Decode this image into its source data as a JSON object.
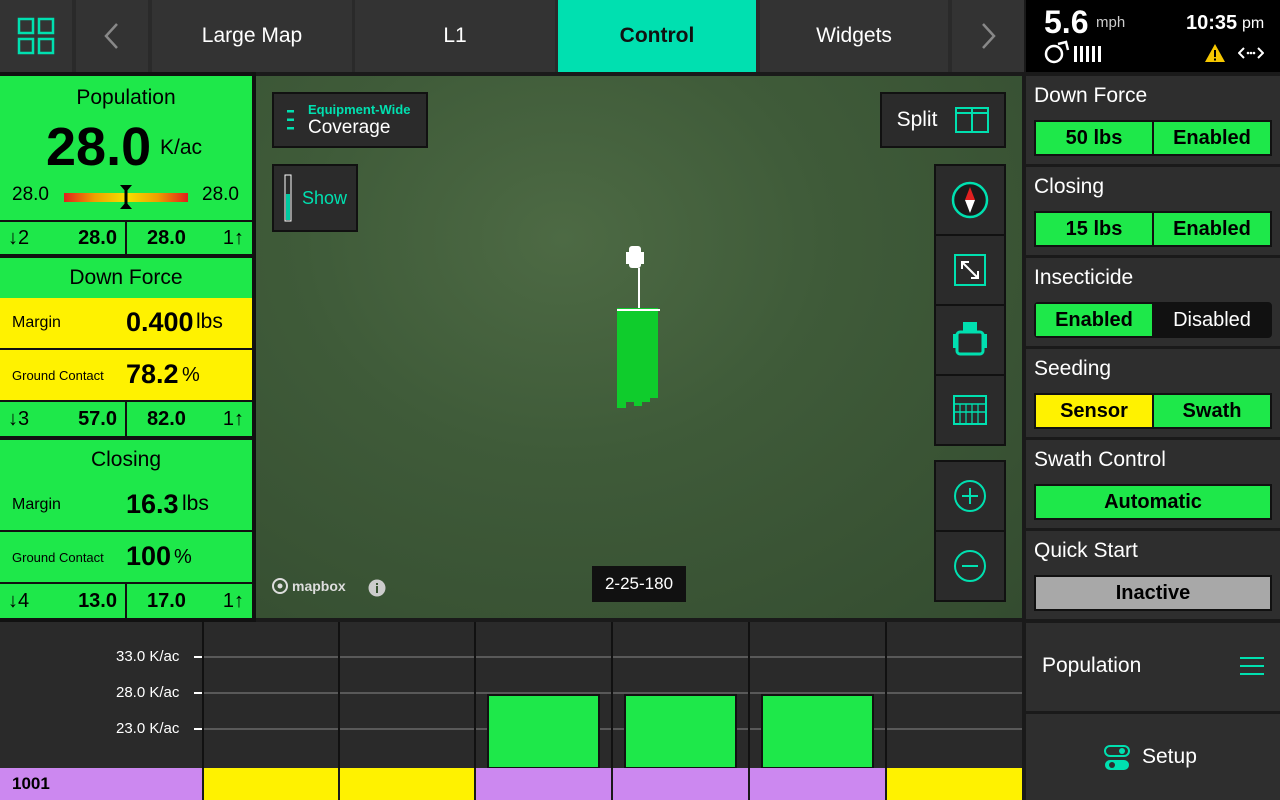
{
  "topbar": {
    "tabs": [
      {
        "label": "Large Map"
      },
      {
        "label": "L1"
      },
      {
        "label": "Control"
      },
      {
        "label": "Widgets"
      }
    ]
  },
  "status": {
    "speed": "5.6",
    "speed_unit": "mph",
    "time": "10:35",
    "ampm": "pm"
  },
  "population": {
    "title": "Population",
    "value": "28.0",
    "unit": "K/ac",
    "min": "28.0",
    "max": "28.0",
    "row": {
      "down_count": "2",
      "a": "28.0",
      "b": "28.0",
      "up_count": "1"
    }
  },
  "down_force": {
    "title": "Down Force",
    "margin_label": "Margin",
    "margin_value": "0.400",
    "margin_unit": "lbs",
    "gc_label": "Ground Contact",
    "gc_value": "78.2",
    "gc_unit": "%",
    "row": {
      "down_count": "3",
      "a": "57.0",
      "b": "82.0",
      "up_count": "1"
    }
  },
  "closing": {
    "title": "Closing",
    "margin_label": "Margin",
    "margin_value": "16.3",
    "margin_unit": "lbs",
    "gc_label": "Ground Contact",
    "gc_value": "100",
    "gc_unit": "%",
    "row": {
      "down_count": "4",
      "a": "13.0",
      "b": "17.0",
      "up_count": "1"
    }
  },
  "map": {
    "coverage_small": "Equipment-Wide",
    "coverage_label": "Coverage",
    "show_label": "Show",
    "split_label": "Split",
    "attribution": "mapbox",
    "location_code": "2-25-180"
  },
  "right": {
    "down_force": {
      "title": "Down Force",
      "left": "50 lbs",
      "right": "Enabled"
    },
    "closing": {
      "title": "Closing",
      "left": "15 lbs",
      "right": "Enabled"
    },
    "insecticide": {
      "title": "Insecticide",
      "left": "Enabled",
      "right": "Disabled"
    },
    "seeding": {
      "title": "Seeding",
      "left": "Sensor",
      "right": "Swath"
    },
    "swath": {
      "title": "Swath Control",
      "value": "Automatic"
    },
    "quick_start": {
      "title": "Quick Start",
      "value": "Inactive"
    },
    "population_label": "Population",
    "setup_label": "Setup"
  },
  "chart": {
    "y_ticks": [
      "33.0 K/ac",
      "28.0 K/ac",
      "23.0 K/ac"
    ],
    "row_label": "1001"
  },
  "colors": {
    "accent": "#00e0b0",
    "green": "#1ee84a",
    "yellow": "#fff200",
    "purple": "#cc88f0"
  }
}
